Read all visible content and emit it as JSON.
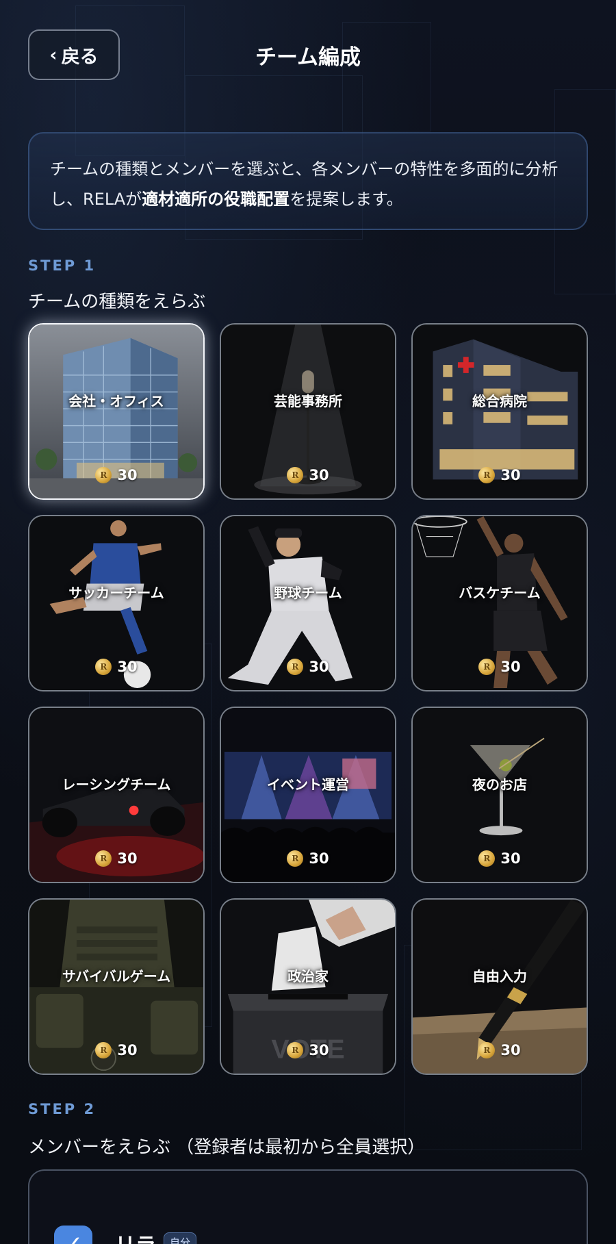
{
  "header": {
    "back_label": "戻る",
    "back_chevron": "‹",
    "title": "チーム編成"
  },
  "intro": {
    "text_before": "チームの種類とメンバーを選ぶと、各メンバーの特性を多面的に分析し、RELAが",
    "text_bold": "適材適所の役職配置",
    "text_after": "を提案します。"
  },
  "step1": {
    "label": "STEP 1",
    "title": "チームの種類をえらぶ"
  },
  "team_types": [
    {
      "label": "会社・オフィス",
      "cost": "30",
      "selected": true,
      "icon": "office-building-icon"
    },
    {
      "label": "芸能事務所",
      "cost": "30",
      "selected": false,
      "icon": "microphone-icon"
    },
    {
      "label": "総合病院",
      "cost": "30",
      "selected": false,
      "icon": "hospital-icon"
    },
    {
      "label": "サッカーチーム",
      "cost": "30",
      "selected": false,
      "icon": "soccer-player-icon"
    },
    {
      "label": "野球チーム",
      "cost": "30",
      "selected": false,
      "icon": "baseball-pitcher-icon"
    },
    {
      "label": "バスケチーム",
      "cost": "30",
      "selected": false,
      "icon": "basketball-player-icon"
    },
    {
      "label": "レーシングチーム",
      "cost": "30",
      "selected": false,
      "icon": "race-car-icon"
    },
    {
      "label": "イベント運営",
      "cost": "30",
      "selected": false,
      "icon": "concert-stage-icon"
    },
    {
      "label": "夜のお店",
      "cost": "30",
      "selected": false,
      "icon": "cocktail-glass-icon"
    },
    {
      "label": "サバイバルゲーム",
      "cost": "30",
      "selected": false,
      "icon": "tactical-vest-icon"
    },
    {
      "label": "政治家",
      "cost": "30",
      "selected": false,
      "icon": "ballot-box-icon"
    },
    {
      "label": "自由入力",
      "cost": "30",
      "selected": false,
      "icon": "fountain-pen-icon"
    }
  ],
  "coin_symbol": "R",
  "ballot_text": "VOTE",
  "step2": {
    "label": "STEP 2",
    "title": "メンバーをえらぶ （登録者は最初から全員選択）"
  },
  "members": [
    {
      "name": "リラ",
      "badge": "自分",
      "checked": true
    }
  ],
  "colors": {
    "accent": "#4a86e0",
    "step_label": "#6f9bd6",
    "background": "#0c0f17"
  }
}
